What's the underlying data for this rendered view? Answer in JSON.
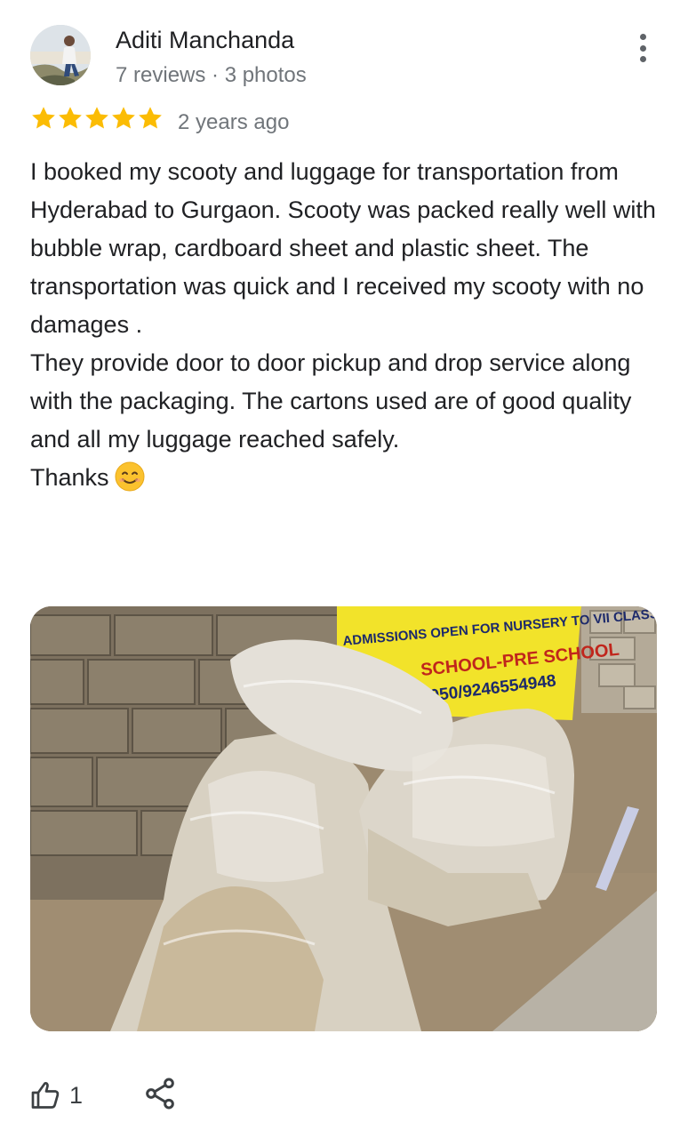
{
  "review": {
    "author_name": "Aditi Manchanda",
    "author_meta": "7 reviews · 3 photos",
    "rating": 5,
    "max_rating": 5,
    "date": "2 years ago",
    "paragraphs": [
      "I booked my scooty and luggage for transportation from Hyderabad to Gurgaon. Scooty was packed really well with bubble wrap, cardboard sheet and plastic sheet. The transportation was quick and I received my scooty with no damages .",
      "They provide door to door pickup and drop service along with the packaging. The cartons used are of good quality and all my luggage reached safely.",
      "Thanks"
    ],
    "emoji_icon": "smiling-face-icon",
    "photo": {
      "sign_line1": "ADMISSIONS OPEN FOR NURSERY TO VII CLASS",
      "sign_line2": "SCHOOL-PRE SCHOOL",
      "sign_line3": "0050/9246554948"
    },
    "actions": {
      "like_count": "1",
      "like_icon": "thumb-up-icon",
      "share_icon": "share-icon",
      "more_icon": "more-vert-icon"
    }
  },
  "colors": {
    "star": "#fbbc04",
    "text_primary": "#202124",
    "text_secondary": "#70757a",
    "icon": "#3c4043"
  }
}
